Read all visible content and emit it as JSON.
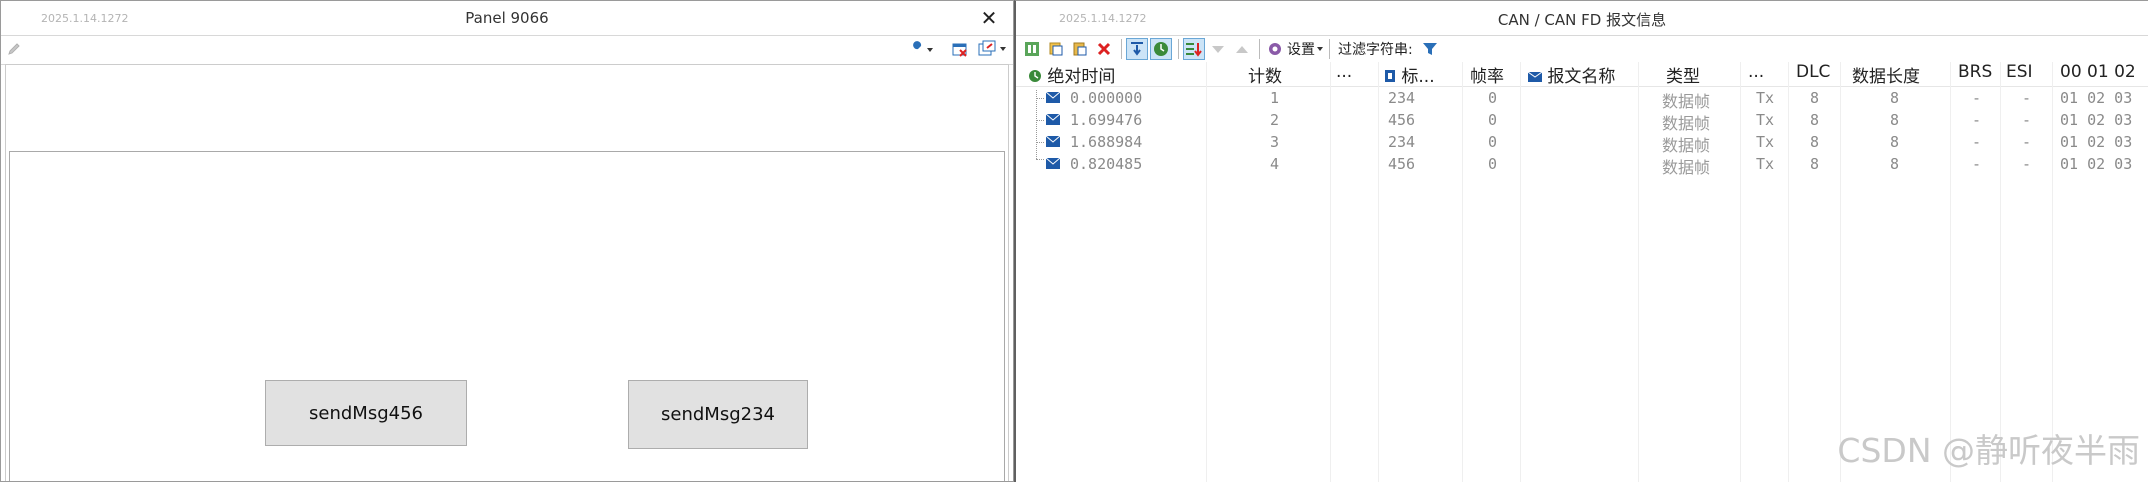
{
  "left_panel": {
    "date_watermark": "2025.1.14.1272",
    "title": "Panel 9066",
    "close_glyph": "✕",
    "buttons": [
      {
        "label": "sendMsg456"
      },
      {
        "label": "sendMsg234"
      }
    ],
    "icons": [
      "pencil-icon",
      "wrench-icon",
      "window-close-icon",
      "window-list-icon"
    ]
  },
  "right_panel": {
    "date_watermark": "2025.1.14.1272",
    "title": "CAN / CAN FD 报文信息",
    "toolbar": {
      "settings_label": "设置",
      "filter_label": "过滤字符串:"
    },
    "columns": {
      "abs_time": "绝对时间",
      "count": "计数",
      "dots1": "...",
      "id": "标...",
      "rate": "帧率",
      "msg_name": "报文名称",
      "type": "类型",
      "dots2": "...",
      "dlc": "DLC",
      "data_len": "数据长度",
      "brs": "BRS",
      "esi": "ESI",
      "data": "00 01 02"
    },
    "rows": [
      {
        "time": "0.000000",
        "count": "1",
        "id": "234",
        "rate": "0",
        "type": "数据帧",
        "dir": "Tx",
        "dlc": "8",
        "len": "8",
        "brs": "-",
        "esi": "-",
        "data": "01 02 03"
      },
      {
        "time": "1.699476",
        "count": "2",
        "id": "456",
        "rate": "0",
        "type": "数据帧",
        "dir": "Tx",
        "dlc": "8",
        "len": "8",
        "brs": "-",
        "esi": "-",
        "data": "01 02 03"
      },
      {
        "time": "1.688984",
        "count": "3",
        "id": "234",
        "rate": "0",
        "type": "数据帧",
        "dir": "Tx",
        "dlc": "8",
        "len": "8",
        "brs": "-",
        "esi": "-",
        "data": "01 02 03"
      },
      {
        "time": "0.820485",
        "count": "4",
        "id": "456",
        "rate": "0",
        "type": "数据帧",
        "dir": "Tx",
        "dlc": "8",
        "len": "8",
        "brs": "-",
        "esi": "-",
        "data": "01 02 03"
      }
    ]
  },
  "watermark": "CSDN @静听夜半雨",
  "colors": {
    "accent": "#1e5aa8",
    "active_bg": "#cce4f7",
    "button_bg": "#e1e1e1"
  }
}
